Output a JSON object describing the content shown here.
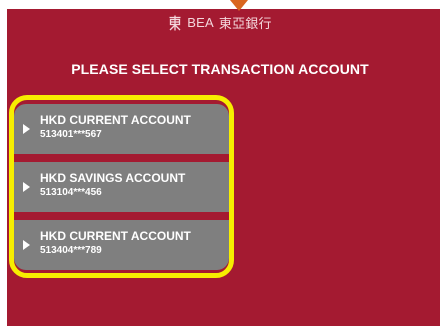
{
  "header": {
    "brand_en": "BEA",
    "brand_zh": "東亞銀行"
  },
  "title": "PLEASE SELECT TRANSACTION ACCOUNT",
  "accounts": [
    {
      "name": "HKD CURRENT ACCOUNT",
      "number": "513401***567"
    },
    {
      "name": "HKD SAVINGS ACCOUNT",
      "number": "513104***456"
    },
    {
      "name": "HKD CURRENT ACCOUNT",
      "number": "513404***789"
    }
  ],
  "colors": {
    "background": "#a41a31",
    "button": "#7f7f7f",
    "highlight": "#f7ee00",
    "pointer": "#d9661f"
  },
  "icons": {
    "logo": "bea-logo-icon",
    "pointer": "down-arrow-icon",
    "selector": "triangle-right-icon"
  }
}
